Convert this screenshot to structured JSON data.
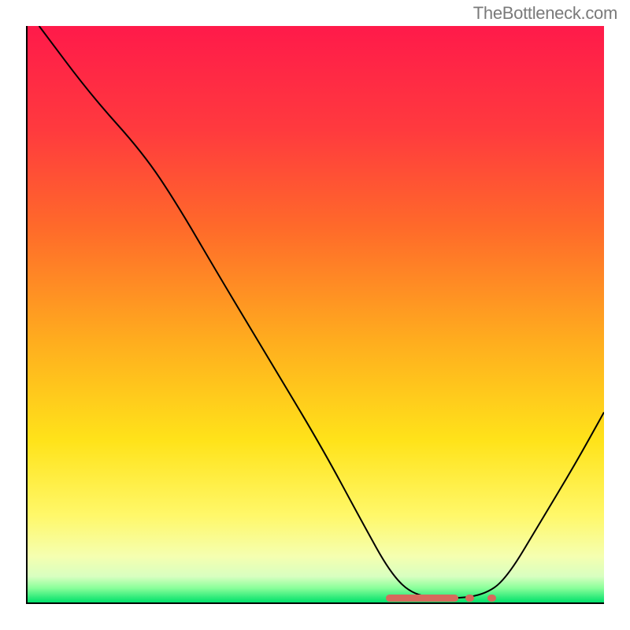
{
  "watermark": "TheBottleneck.com",
  "chart_data": {
    "type": "line",
    "title": "",
    "xlabel": "",
    "ylabel": "",
    "xlim": [
      0,
      100
    ],
    "ylim": [
      0,
      100
    ],
    "dip_x": 73,
    "dip_band": [
      62,
      81
    ],
    "gradient_stops": [
      {
        "offset": 0,
        "color": "#ff1a4a"
      },
      {
        "offset": 18,
        "color": "#ff3a3e"
      },
      {
        "offset": 35,
        "color": "#ff6a2a"
      },
      {
        "offset": 55,
        "color": "#ffae1e"
      },
      {
        "offset": 72,
        "color": "#ffe31a"
      },
      {
        "offset": 85,
        "color": "#fff86a"
      },
      {
        "offset": 92,
        "color": "#f5ffb0"
      },
      {
        "offset": 95.5,
        "color": "#d8ffc0"
      },
      {
        "offset": 97.5,
        "color": "#8aff9a"
      },
      {
        "offset": 100,
        "color": "#00e06a"
      }
    ],
    "curve_points": [
      {
        "x": 2,
        "y": 100
      },
      {
        "x": 11,
        "y": 88
      },
      {
        "x": 20,
        "y": 78
      },
      {
        "x": 26,
        "y": 69
      },
      {
        "x": 33,
        "y": 57
      },
      {
        "x": 42,
        "y": 42
      },
      {
        "x": 51,
        "y": 27
      },
      {
        "x": 58,
        "y": 14
      },
      {
        "x": 63,
        "y": 5
      },
      {
        "x": 67,
        "y": 1.2
      },
      {
        "x": 73,
        "y": 0.6
      },
      {
        "x": 79,
        "y": 1.2
      },
      {
        "x": 83,
        "y": 4
      },
      {
        "x": 89,
        "y": 14
      },
      {
        "x": 95,
        "y": 24
      },
      {
        "x": 100,
        "y": 33
      }
    ],
    "highlight_segments": [
      {
        "start": 62,
        "end": 74.5
      },
      {
        "start": 75.8,
        "end": 77.2
      },
      {
        "start": 79.5,
        "end": 81
      }
    ]
  }
}
